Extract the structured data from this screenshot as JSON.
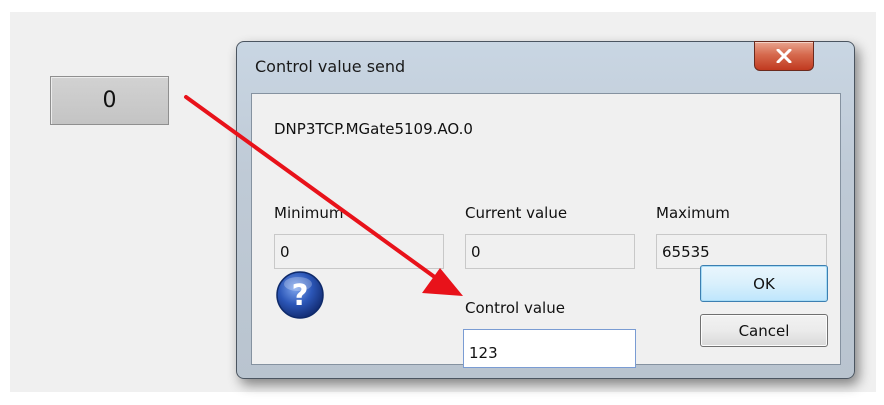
{
  "tile": {
    "value": "0"
  },
  "dialog": {
    "title": "Control value send",
    "tag": "DNP3TCP.MGate5109.AO.0",
    "minimum": {
      "label": "Minimum",
      "value": "0"
    },
    "current": {
      "label": "Current value",
      "value": "0"
    },
    "maximum": {
      "label": "Maximum",
      "value": "65535"
    },
    "control": {
      "label": "Control value",
      "value": "123"
    },
    "ok_label": "OK",
    "cancel_label": "Cancel"
  },
  "colors": {
    "annotation_arrow": "#e8121a",
    "close_button": "#c9472b",
    "help_icon": "#2c57b8"
  },
  "icons": [
    "close-icon",
    "help-icon",
    "annotation-arrow"
  ]
}
